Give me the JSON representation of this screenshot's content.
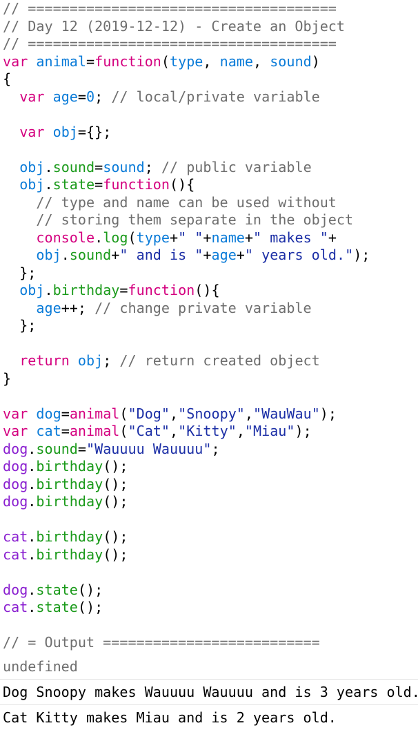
{
  "colors": {
    "comment": "#6e6e6e",
    "keyword": "#d4007f",
    "variable": "#0a7bd8",
    "string": "#1c2fa6",
    "method": "#1a9a1a",
    "object": "#8a1fd0",
    "text": "#000000"
  },
  "code_lines": [
    [
      {
        "t": "// =====================================",
        "c": "comment"
      }
    ],
    [
      {
        "t": "// Day 12 (2019-12-12) - Create an Object",
        "c": "comment"
      }
    ],
    [
      {
        "t": "// =====================================",
        "c": "comment"
      }
    ],
    [
      {
        "t": "var",
        "c": "keyword"
      },
      {
        "t": " ",
        "c": "op"
      },
      {
        "t": "animal",
        "c": "var"
      },
      {
        "t": "=",
        "c": "op"
      },
      {
        "t": "function",
        "c": "keyword"
      },
      {
        "t": "(",
        "c": "op"
      },
      {
        "t": "type",
        "c": "var"
      },
      {
        "t": ", ",
        "c": "op"
      },
      {
        "t": "name",
        "c": "var"
      },
      {
        "t": ", ",
        "c": "op"
      },
      {
        "t": "sound",
        "c": "var"
      },
      {
        "t": ")",
        "c": "op"
      }
    ],
    [
      {
        "t": "{",
        "c": "op"
      }
    ],
    [
      {
        "t": "  ",
        "c": "op"
      },
      {
        "t": "var",
        "c": "keyword"
      },
      {
        "t": " ",
        "c": "op"
      },
      {
        "t": "age",
        "c": "var"
      },
      {
        "t": "=",
        "c": "op"
      },
      {
        "t": "0",
        "c": "num"
      },
      {
        "t": "; ",
        "c": "op"
      },
      {
        "t": "// local/private variable",
        "c": "comment"
      }
    ],
    [],
    [
      {
        "t": "  ",
        "c": "op"
      },
      {
        "t": "var",
        "c": "keyword"
      },
      {
        "t": " ",
        "c": "op"
      },
      {
        "t": "obj",
        "c": "var"
      },
      {
        "t": "={};",
        "c": "op"
      }
    ],
    [],
    [
      {
        "t": "  ",
        "c": "op"
      },
      {
        "t": "obj",
        "c": "var"
      },
      {
        "t": ".",
        "c": "op"
      },
      {
        "t": "sound",
        "c": "call"
      },
      {
        "t": "=",
        "c": "op"
      },
      {
        "t": "sound",
        "c": "var"
      },
      {
        "t": "; ",
        "c": "op"
      },
      {
        "t": "// public variable",
        "c": "comment"
      }
    ],
    [
      {
        "t": "  ",
        "c": "op"
      },
      {
        "t": "obj",
        "c": "var"
      },
      {
        "t": ".",
        "c": "op"
      },
      {
        "t": "state",
        "c": "call"
      },
      {
        "t": "=",
        "c": "op"
      },
      {
        "t": "function",
        "c": "keyword"
      },
      {
        "t": "(){",
        "c": "op"
      }
    ],
    [
      {
        "t": "    ",
        "c": "op"
      },
      {
        "t": "// type and name can be used without",
        "c": "comment"
      }
    ],
    [
      {
        "t": "    ",
        "c": "op"
      },
      {
        "t": "// storing them separate in the object",
        "c": "comment"
      }
    ],
    [
      {
        "t": "    ",
        "c": "op"
      },
      {
        "t": "console",
        "c": "keyword"
      },
      {
        "t": ".",
        "c": "op"
      },
      {
        "t": "log",
        "c": "call"
      },
      {
        "t": "(",
        "c": "op"
      },
      {
        "t": "type",
        "c": "var"
      },
      {
        "t": "+",
        "c": "op"
      },
      {
        "t": "\" \"",
        "c": "str"
      },
      {
        "t": "+",
        "c": "op"
      },
      {
        "t": "name",
        "c": "var"
      },
      {
        "t": "+",
        "c": "op"
      },
      {
        "t": "\" makes \"",
        "c": "str"
      },
      {
        "t": "+",
        "c": "op"
      }
    ],
    [
      {
        "t": "    ",
        "c": "op"
      },
      {
        "t": "obj",
        "c": "var"
      },
      {
        "t": ".",
        "c": "op"
      },
      {
        "t": "sound",
        "c": "call"
      },
      {
        "t": "+",
        "c": "op"
      },
      {
        "t": "\" and is \"",
        "c": "str"
      },
      {
        "t": "+",
        "c": "op"
      },
      {
        "t": "age",
        "c": "var"
      },
      {
        "t": "+",
        "c": "op"
      },
      {
        "t": "\" years old.\"",
        "c": "str"
      },
      {
        "t": ");",
        "c": "op"
      }
    ],
    [
      {
        "t": "  };",
        "c": "op"
      }
    ],
    [
      {
        "t": "  ",
        "c": "op"
      },
      {
        "t": "obj",
        "c": "var"
      },
      {
        "t": ".",
        "c": "op"
      },
      {
        "t": "birthday",
        "c": "call"
      },
      {
        "t": "=",
        "c": "op"
      },
      {
        "t": "function",
        "c": "keyword"
      },
      {
        "t": "(){",
        "c": "op"
      }
    ],
    [
      {
        "t": "    ",
        "c": "op"
      },
      {
        "t": "age",
        "c": "var"
      },
      {
        "t": "++; ",
        "c": "op"
      },
      {
        "t": "// change private variable",
        "c": "comment"
      }
    ],
    [
      {
        "t": "  };",
        "c": "op"
      }
    ],
    [],
    [
      {
        "t": "  ",
        "c": "op"
      },
      {
        "t": "return",
        "c": "keyword"
      },
      {
        "t": " ",
        "c": "op"
      },
      {
        "t": "obj",
        "c": "var"
      },
      {
        "t": "; ",
        "c": "op"
      },
      {
        "t": "// return created object",
        "c": "comment"
      }
    ],
    [
      {
        "t": "}",
        "c": "op"
      }
    ],
    [],
    [
      {
        "t": "var",
        "c": "keyword"
      },
      {
        "t": " ",
        "c": "op"
      },
      {
        "t": "dog",
        "c": "var"
      },
      {
        "t": "=",
        "c": "op"
      },
      {
        "t": "animal",
        "c": "keyword"
      },
      {
        "t": "(",
        "c": "op"
      },
      {
        "t": "\"Dog\"",
        "c": "str"
      },
      {
        "t": ",",
        "c": "op"
      },
      {
        "t": "\"Snoopy\"",
        "c": "str"
      },
      {
        "t": ",",
        "c": "op"
      },
      {
        "t": "\"WauWau\"",
        "c": "str"
      },
      {
        "t": ");",
        "c": "op"
      }
    ],
    [
      {
        "t": "var",
        "c": "keyword"
      },
      {
        "t": " ",
        "c": "op"
      },
      {
        "t": "cat",
        "c": "var"
      },
      {
        "t": "=",
        "c": "op"
      },
      {
        "t": "animal",
        "c": "keyword"
      },
      {
        "t": "(",
        "c": "op"
      },
      {
        "t": "\"Cat\"",
        "c": "str"
      },
      {
        "t": ",",
        "c": "op"
      },
      {
        "t": "\"Kitty\"",
        "c": "str"
      },
      {
        "t": ",",
        "c": "op"
      },
      {
        "t": "\"Miau\"",
        "c": "str"
      },
      {
        "t": ");",
        "c": "op"
      }
    ],
    [
      {
        "t": "dog",
        "c": "obj"
      },
      {
        "t": ".",
        "c": "op"
      },
      {
        "t": "sound",
        "c": "call"
      },
      {
        "t": "=",
        "c": "op"
      },
      {
        "t": "\"Wauuuu Wauuuu\"",
        "c": "str"
      },
      {
        "t": ";",
        "c": "op"
      }
    ],
    [
      {
        "t": "dog",
        "c": "obj"
      },
      {
        "t": ".",
        "c": "op"
      },
      {
        "t": "birthday",
        "c": "call"
      },
      {
        "t": "();",
        "c": "op"
      }
    ],
    [
      {
        "t": "dog",
        "c": "obj"
      },
      {
        "t": ".",
        "c": "op"
      },
      {
        "t": "birthday",
        "c": "call"
      },
      {
        "t": "();",
        "c": "op"
      }
    ],
    [
      {
        "t": "dog",
        "c": "obj"
      },
      {
        "t": ".",
        "c": "op"
      },
      {
        "t": "birthday",
        "c": "call"
      },
      {
        "t": "();",
        "c": "op"
      }
    ],
    [],
    [
      {
        "t": "cat",
        "c": "obj"
      },
      {
        "t": ".",
        "c": "op"
      },
      {
        "t": "birthday",
        "c": "call"
      },
      {
        "t": "();",
        "c": "op"
      }
    ],
    [
      {
        "t": "cat",
        "c": "obj"
      },
      {
        "t": ".",
        "c": "op"
      },
      {
        "t": "birthday",
        "c": "call"
      },
      {
        "t": "();",
        "c": "op"
      }
    ],
    [],
    [
      {
        "t": "dog",
        "c": "obj"
      },
      {
        "t": ".",
        "c": "op"
      },
      {
        "t": "state",
        "c": "call"
      },
      {
        "t": "();",
        "c": "op"
      }
    ],
    [
      {
        "t": "cat",
        "c": "obj"
      },
      {
        "t": ".",
        "c": "op"
      },
      {
        "t": "state",
        "c": "call"
      },
      {
        "t": "();",
        "c": "op"
      }
    ],
    [],
    [
      {
        "t": "// = Output ==========================",
        "c": "comment"
      }
    ]
  ],
  "console": {
    "return_value": "undefined",
    "logs": [
      "Dog Snoopy makes Wauuuu Wauuuu and is 3 years old.",
      "Cat Kitty makes Miau and is 2 years old."
    ]
  }
}
